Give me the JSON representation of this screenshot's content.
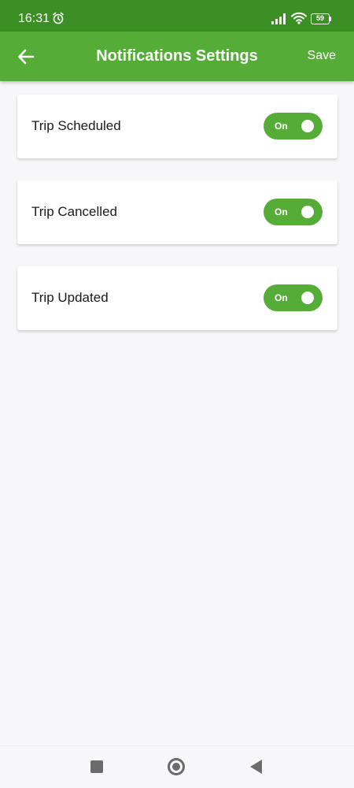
{
  "status_bar": {
    "time": "16:31",
    "battery": "59",
    "icons": [
      "alarm-icon",
      "signal-icon",
      "wifi-icon",
      "battery-icon"
    ]
  },
  "app_bar": {
    "title": "Notifications Settings",
    "save_label": "Save",
    "back_icon": "arrow-left-icon"
  },
  "settings": [
    {
      "label": "Trip Scheduled",
      "toggle_text": "On",
      "enabled": true
    },
    {
      "label": "Trip Cancelled",
      "toggle_text": "On",
      "enabled": true
    },
    {
      "label": "Trip Updated",
      "toggle_text": "On",
      "enabled": true
    }
  ],
  "nav_bar": {
    "icons": [
      "recents-square-icon",
      "home-circle-icon",
      "back-triangle-icon"
    ]
  },
  "colors": {
    "status_bar": "#3b8f24",
    "app_bar": "#55ad37",
    "toggle_on": "#55ad37",
    "background": "#f7f6f8",
    "card": "#ffffff",
    "text": "#1a1a1a"
  }
}
